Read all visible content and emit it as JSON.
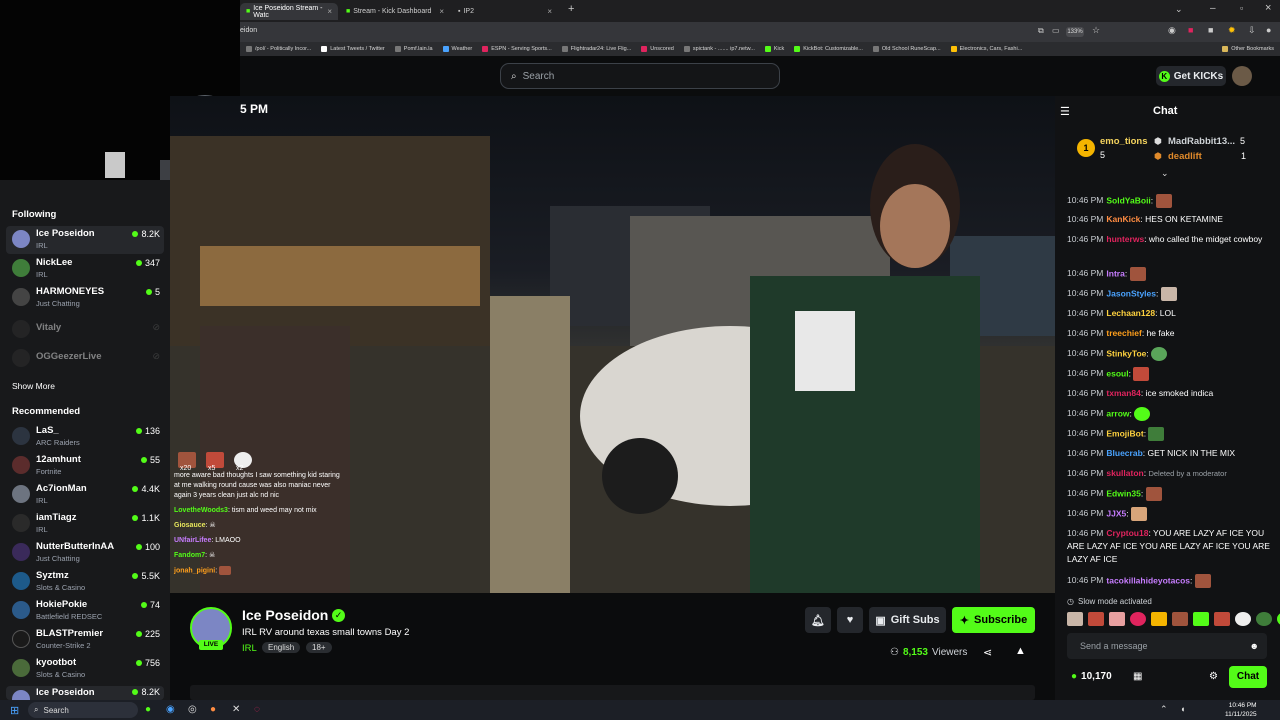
{
  "browser": {
    "tabs": [
      {
        "label": "Ice Poseidon Stream - Watc",
        "active": true
      },
      {
        "label": "Stream - Kick Dashboard",
        "active": false
      },
      {
        "label": "IP2",
        "active": false
      }
    ],
    "url_fragment": "eidon",
    "zoom": "133%",
    "bookmarks": [
      "/pol/ - Politically Incor...",
      "Latest Tweets / Twitter",
      "Pomf.lain.la",
      "Weather",
      "ESPN - Serving Sports...",
      "Flightradar24: Live Flig...",
      "Unscored",
      "spictank - ....... ip7.netw...",
      "Kick",
      "KickBot: Customizable...",
      "Old School RuneScap...",
      "Electronics, Cars, Fashi..."
    ],
    "other_bookmarks": "Other Bookmarks"
  },
  "header": {
    "search_placeholder": "Search",
    "get_kicks": "Get KICKs"
  },
  "sidebar": {
    "following_title": "Following",
    "following": [
      {
        "name": "Ice Poseidon",
        "category": "IRL",
        "viewers": "8.2K",
        "live": true,
        "selected": true,
        "color": "#7c86c4"
      },
      {
        "name": "NickLee",
        "category": "IRL",
        "viewers": "347",
        "live": true,
        "color": "#3f7d3a"
      },
      {
        "name": "HARMONEYES",
        "category": "Just Chatting",
        "viewers": "5",
        "live": true,
        "color": "#444"
      },
      {
        "name": "Vitaly",
        "category": "",
        "viewers": "",
        "live": false,
        "color": "#333"
      },
      {
        "name": "OGGeezerLive",
        "category": "",
        "viewers": "",
        "live": false,
        "color": "#333"
      }
    ],
    "show_more": "Show More",
    "recommended_title": "Recommended",
    "recommended": [
      {
        "name": "LaS_",
        "category": "ARC Raiders",
        "viewers": "136",
        "color": "#2c3440"
      },
      {
        "name": "12amhunt",
        "category": "Fortnite",
        "viewers": "55",
        "color": "#5b2c2c"
      },
      {
        "name": "Ac7ionMan",
        "category": "IRL",
        "viewers": "4.4K",
        "color": "#6d7480"
      },
      {
        "name": "iamTiagz",
        "category": "IRL",
        "viewers": "1.1K",
        "color": "#2a2a2a"
      },
      {
        "name": "NutterButterInAA",
        "category": "Just Chatting",
        "viewers": "100",
        "color": "#3a2a5a"
      },
      {
        "name": "Syztmz",
        "category": "Slots & Casino",
        "viewers": "5.5K",
        "color": "#1d5a8a"
      },
      {
        "name": "HokiePokie",
        "category": "Battlefield REDSEC",
        "viewers": "74",
        "color": "#2b5a8a"
      },
      {
        "name": "BLASTPremier",
        "category": "Counter-Strike 2",
        "viewers": "225",
        "color": "#1a1a1a"
      },
      {
        "name": "kyootbot",
        "category": "Slots & Casino",
        "viewers": "756",
        "color": "#4a6a3a"
      },
      {
        "name": "Ice Poseidon",
        "category": "",
        "viewers": "8.2K",
        "color": "#7c86c4"
      }
    ]
  },
  "video": {
    "clock": "5 PM",
    "overlay_counts": [
      "x20",
      "x5",
      "x2"
    ],
    "overlay_chat": [
      {
        "user": "",
        "text": "more aware bad thoughts I saw something kid staring"
      },
      {
        "user": "",
        "text": "at me walking round cause was also maniac never"
      },
      {
        "user": "",
        "text": "again 3 years clean just alc nd nic"
      },
      {
        "user": "LovetheWoods3",
        "text": "tism and weed may not mix",
        "color": "#53fc18"
      },
      {
        "user": "Giosauce",
        "text": "",
        "color": "#e6e65c"
      },
      {
        "user": "UNfairLifee",
        "text": "LMAOO",
        "color": "#c77dff"
      },
      {
        "user": "Fandom7",
        "text": "",
        "color": "#53fc18"
      },
      {
        "user": "jonah_pigini",
        "text": "",
        "color": "#ff9f1c"
      }
    ]
  },
  "stream": {
    "streamer": "Ice Poseidon",
    "title": "IRL RV around texas small towns Day 2",
    "category": "IRL",
    "tags": [
      "English",
      "18+"
    ],
    "live_badge": "LIVE",
    "viewers": "8,153",
    "viewers_label": "Viewers",
    "gift_subs": "Gift Subs",
    "subscribe": "Subscribe",
    "accent": "#53fc18"
  },
  "chat": {
    "title": "Chat",
    "leaderboard": [
      {
        "rank": "1",
        "name": "emo_tions",
        "count": "5"
      },
      {
        "name": "MadRabbit13...",
        "count": "5"
      },
      {
        "name": "deadlift",
        "count": "1"
      }
    ],
    "messages": [
      {
        "time": "10:46 PM",
        "user": "SoldYaBoii",
        "text": "",
        "color": "#53fc18",
        "emote": true
      },
      {
        "time": "10:46 PM",
        "user": "KanKick",
        "text": "HES ON KETAMINE",
        "color": "#ff8c42"
      },
      {
        "time": "10:46 PM",
        "user": "hunterws",
        "text": "who called the midget cowboy",
        "color": "#e0245e"
      },
      {
        "time": "10:46 PM",
        "user": "Intra",
        "text": "",
        "color": "#c77dff",
        "emote": true
      },
      {
        "time": "10:46 PM",
        "user": "JasonStyles",
        "text": "",
        "color": "#4aa3ff",
        "emote": true
      },
      {
        "time": "10:46 PM",
        "user": "Lechaan128",
        "text": "LOL",
        "color": "#ffd23f"
      },
      {
        "time": "10:46 PM",
        "user": "treechief",
        "text": "he fake",
        "color": "#ff9f1c"
      },
      {
        "time": "10:46 PM",
        "user": "StinkyToe",
        "text": "",
        "color": "#ffd23f",
        "emote": true
      },
      {
        "time": "10:46 PM",
        "user": "esoul",
        "text": "",
        "color": "#53fc18",
        "emote": true
      },
      {
        "time": "10:46 PM",
        "user": "txman84",
        "text": "ice smoked indica",
        "color": "#e0245e"
      },
      {
        "time": "10:46 PM",
        "user": "arrow",
        "text": "",
        "color": "#53fc18",
        "emote": true
      },
      {
        "time": "10:46 PM",
        "user": "EmojiBot",
        "text": "",
        "color": "#ffd23f",
        "emote": true
      },
      {
        "time": "10:46 PM",
        "user": "Bluecrab",
        "text": "GET NICK IN THE MIX",
        "color": "#4aa3ff"
      },
      {
        "time": "10:46 PM",
        "user": "skullaton",
        "text": "Deleted by a moderator",
        "color": "#e0245e",
        "deleted": true
      },
      {
        "time": "10:46 PM",
        "user": "Edwin35",
        "text": "",
        "color": "#53fc18",
        "emote": true
      },
      {
        "time": "10:46 PM",
        "user": "JJX5",
        "text": "",
        "color": "#c77dff",
        "emote": true
      },
      {
        "time": "10:46 PM",
        "user": "Cryptou18",
        "text": "YOU ARE LAZY AF ICE YOU ARE LAZY AF ICE YOU ARE LAZY AF ICE YOU ARE LAZY AF ICE",
        "color": "#e0245e"
      },
      {
        "time": "10:46 PM",
        "user": "tacokillahideyotacos",
        "text": "",
        "color": "#c77dff",
        "emote": true
      }
    ],
    "slow_mode": "Slow mode activated",
    "input_placeholder": "Send a message",
    "kicks_balance": "10,170",
    "send_button": "Chat"
  },
  "taskbar": {
    "search_placeholder": "Search",
    "time": "10:46 PM",
    "date": "11/11/2025"
  }
}
